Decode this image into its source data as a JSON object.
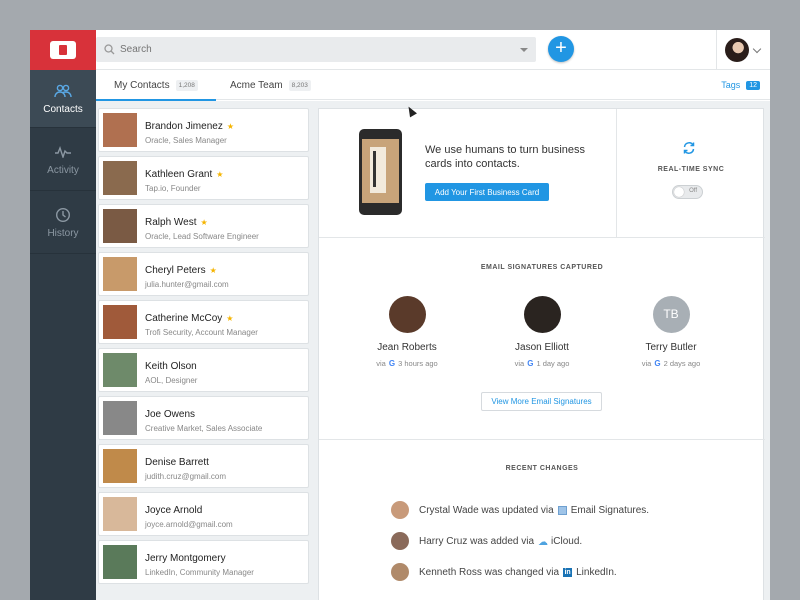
{
  "nav": {
    "items": [
      {
        "label": "Contacts",
        "icon": "people-icon"
      },
      {
        "label": "Activity",
        "icon": "activity-icon"
      },
      {
        "label": "History",
        "icon": "clock-icon"
      }
    ]
  },
  "search": {
    "placeholder": "Search"
  },
  "tabs": [
    {
      "label": "My Contacts",
      "count": "1,208"
    },
    {
      "label": "Acme Team",
      "count": "8,203"
    }
  ],
  "tags": {
    "label": "Tags",
    "count": "12"
  },
  "contacts": [
    {
      "name": "Brandon Jimenez",
      "sub": "Oracle, Sales Manager",
      "star": "★",
      "photo": "#b07050"
    },
    {
      "name": "Kathleen Grant",
      "sub": "Tap.io, Founder",
      "star": "★",
      "photo": "#8a6a4e"
    },
    {
      "name": "Ralph West",
      "sub": "Oracle, Lead Software Engineer",
      "star": "★",
      "photo": "#7a5a44"
    },
    {
      "name": "Cheryl Peters",
      "sub": "julia.hunter@gmail.com",
      "star": "★",
      "photo": "#c89a6a"
    },
    {
      "name": "Catherine McCoy",
      "sub": "Trofi Security, Account Manager",
      "star": "★",
      "photo": "#a05a3a"
    },
    {
      "name": "Keith Olson",
      "sub": "AOL, Designer",
      "star": "",
      "photo": "#6e8a6a"
    },
    {
      "name": "Joe Owens",
      "sub": "Creative Market, Sales Associate",
      "star": "",
      "photo": "#888888"
    },
    {
      "name": "Denise Barrett",
      "sub": "judith.cruz@gmail.com",
      "star": "",
      "photo": "#c08a4a"
    },
    {
      "name": "Joyce Arnold",
      "sub": "joyce.arnold@gmail.com",
      "star": "",
      "photo": "#d8b89a"
    },
    {
      "name": "Jerry Montgomery",
      "sub": "LinkedIn, Community Manager",
      "star": "",
      "photo": "#5a7a5a"
    }
  ],
  "hero": {
    "text": "We use humans to turn business cards into contacts.",
    "button": "Add Your First Business Card"
  },
  "sync": {
    "title": "REAL-TIME SYNC",
    "toggle": "Off"
  },
  "signatures": {
    "title": "EMAIL SIGNATURES CAPTURED",
    "people": [
      {
        "name": "Jean Roberts",
        "via": "via",
        "time": "3 hours ago",
        "initials": "",
        "photo": "#5a3a2a"
      },
      {
        "name": "Jason Elliott",
        "via": "via",
        "time": "1 day ago",
        "initials": "",
        "photo": "#2a2420"
      },
      {
        "name": "Terry Butler",
        "via": "via",
        "time": "2 days ago",
        "initials": "TB",
        "photo": "#a8afb5"
      }
    ],
    "more_button": "View More Email Signatures"
  },
  "recent": {
    "title": "RECENT CHANGES",
    "items": [
      {
        "before": "Crystal Wade was updated via",
        "source": "Email Signatures.",
        "icon": "email-icon",
        "photo": "#c89a7a"
      },
      {
        "before": "Harry Cruz was added via",
        "source": "iCloud.",
        "icon": "icloud-icon",
        "photo": "#8a6a5a"
      },
      {
        "before": "Kenneth Ross was changed via",
        "source": "LinkedIn.",
        "icon": "linkedin-icon",
        "photo": "#b08a6a"
      }
    ]
  },
  "colors": {
    "accent": "#2196e3",
    "brand": "#d8323a",
    "rail": "#2f3b45",
    "star": "#f5b400"
  }
}
